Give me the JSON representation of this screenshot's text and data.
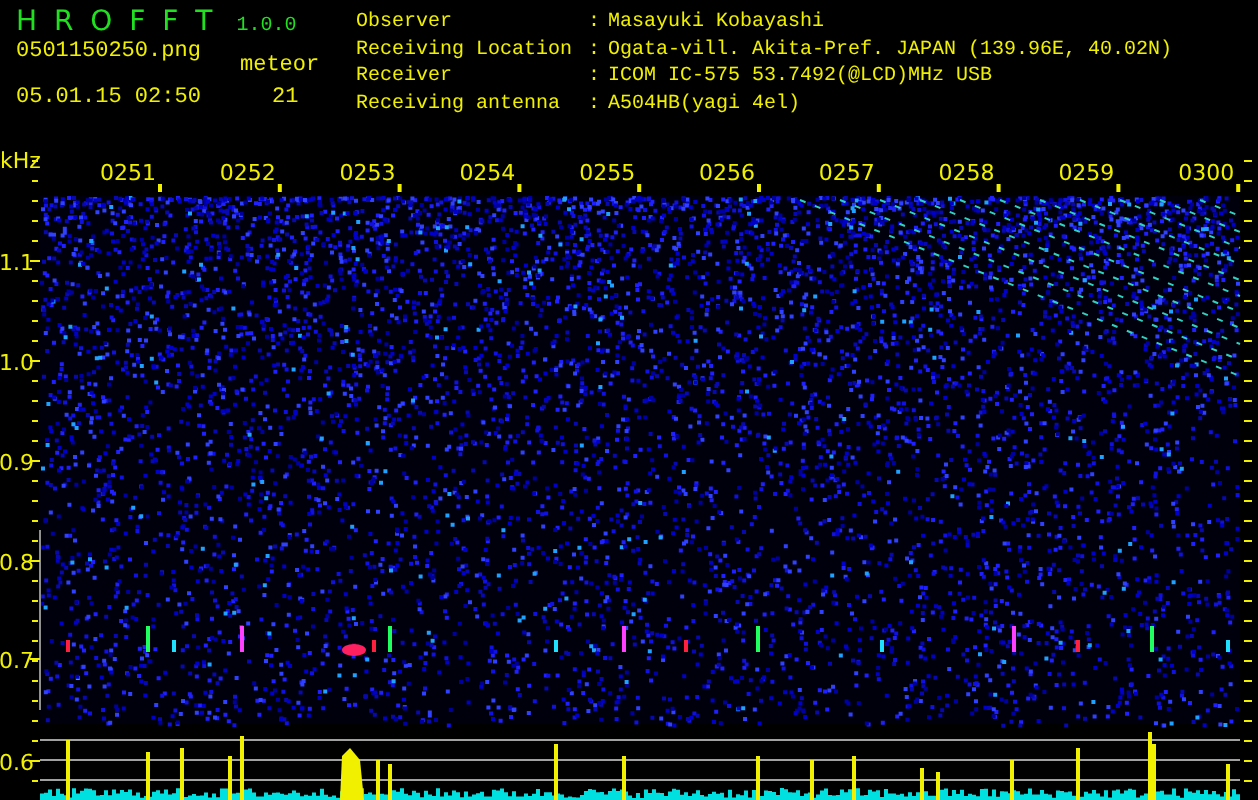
{
  "app": {
    "name": "H R O F F T",
    "version": "1.0.0",
    "file": "0501150250.png",
    "datetime": "05.01.15 02:50",
    "meteor_label": "meteor",
    "meteor_count": "21"
  },
  "info": [
    {
      "label": "Observer",
      "separator": ":",
      "value": "Masayuki Kobayashi"
    },
    {
      "label": "Receiving Location",
      "separator": ":",
      "value": "Ogata-vill. Akita-Pref. JAPAN (139.96E, 40.02N)"
    },
    {
      "label": "Receiver",
      "separator": ":",
      "value": "ICOM IC-575 53.7492(@LCD)MHz USB"
    },
    {
      "label": "Receiving antenna",
      "separator": ":",
      "value": "A504HB(yagi 4el)"
    }
  ],
  "plot": {
    "unit": "kHz",
    "time_labels": [
      "0251",
      "0252",
      "0253",
      "0254",
      "0255",
      "0256",
      "0257",
      "0258",
      "0259",
      "0300"
    ],
    "freq_labels": [
      "1.1",
      "1.0",
      "0.9",
      "0.8",
      "0.7",
      "0.6"
    ]
  }
}
